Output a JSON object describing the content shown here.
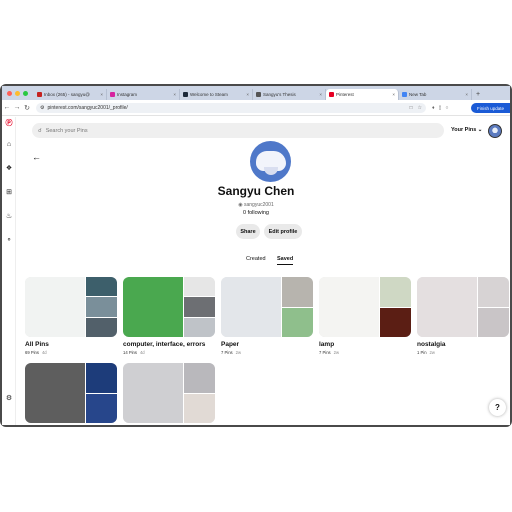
{
  "tabs": [
    {
      "label": "Inbox (265) - sangyu@",
      "color": "#c5221f",
      "active": false
    },
    {
      "label": "Instagram",
      "color": "#d6249f",
      "active": false
    },
    {
      "label": "Welcome to Steam",
      "color": "#1b2838",
      "active": false
    },
    {
      "label": "Sangyu's Thesis",
      "color": "#555555",
      "active": false
    },
    {
      "label": "Pinterest",
      "color": "#e60023",
      "active": true
    },
    {
      "label": "New Tab",
      "color": "#4285f4",
      "active": false
    }
  ],
  "browser": {
    "url": "pinterest.com/sangyuc2001/_profile/",
    "finish_label": "Finish update"
  },
  "header": {
    "search_placeholder": "Search your Pins",
    "your_pins_label": "Your Pins"
  },
  "profile": {
    "name": "Sangyu Chen",
    "handle": "sangyuc2001",
    "following": "0 following",
    "share_label": "Share",
    "edit_label": "Edit profile"
  },
  "tabs_profile": {
    "created": "Created",
    "saved": "Saved"
  },
  "boards": [
    {
      "title": "All Pins",
      "count": "69 Pins",
      "age": "4d",
      "colors": [
        "#f1f3f2",
        "#3d5f6b",
        "#7a8f9a",
        "#52606a"
      ]
    },
    {
      "title": "computer, interface, errors",
      "count": "14 Pins",
      "age": "4d",
      "colors": [
        "#4aa84f",
        "#e6e6e6",
        "#6d6f73",
        "#bfc3c8"
      ]
    },
    {
      "title": "Paper",
      "count": "7 Pins",
      "age": "2w",
      "colors": [
        "#e3e6ea",
        "#b7b4ae",
        "#8fbf8c"
      ]
    },
    {
      "title": "lamp",
      "count": "7 Pins",
      "age": "2w",
      "colors": [
        "#f4f4f2",
        "#cfd8c4",
        "#5b1e14"
      ]
    },
    {
      "title": "nostalgia",
      "count": "1 Pin",
      "age": "2w",
      "colors": [
        "#e4dfe0",
        "#d7d3d4",
        "#c9c5c7"
      ]
    },
    {
      "title": "",
      "count": "",
      "age": "",
      "colors": [
        "#5e5e5e",
        "#1d3c7a",
        "#27468b"
      ]
    },
    {
      "title": "",
      "count": "",
      "age": "",
      "colors": [
        "#cfcfd2",
        "#b9b8bc",
        "#e1dad5"
      ]
    }
  ],
  "help_label": "?"
}
